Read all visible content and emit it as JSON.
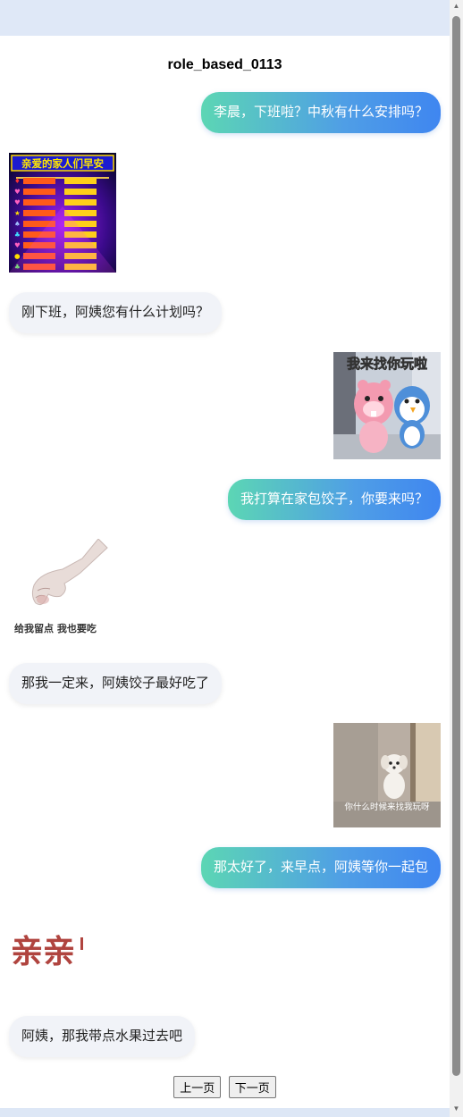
{
  "header": {
    "title": "role_based_0113"
  },
  "messages": {
    "m1": "李晨，下班啦？中秋有什么安排吗？",
    "m3": "刚下班，阿姨您有什么计划吗？",
    "m5": "我打算在家包饺子，你要来吗？",
    "m7": "那我一定来，阿姨饺子最好吃了",
    "m9": "那太好了，来早点，阿姨等你一起包",
    "m11": "阿姨，那我带点水果过去吧"
  },
  "stickers": {
    "s2_title": "亲爱的家人们早安",
    "s4_caption": "我来找你玩啦",
    "s6_caption": "给我留点 我也要吃",
    "s8_caption": "你什么时候来找我玩呀",
    "s10_text": "亲亲"
  },
  "pager": {
    "prev": "上一页",
    "next": "下一页"
  },
  "colors": {
    "user_bubble_start": "#5cd6b4",
    "user_bubble_end": "#3f86f0",
    "bot_bubble": "#f1f3f8"
  }
}
